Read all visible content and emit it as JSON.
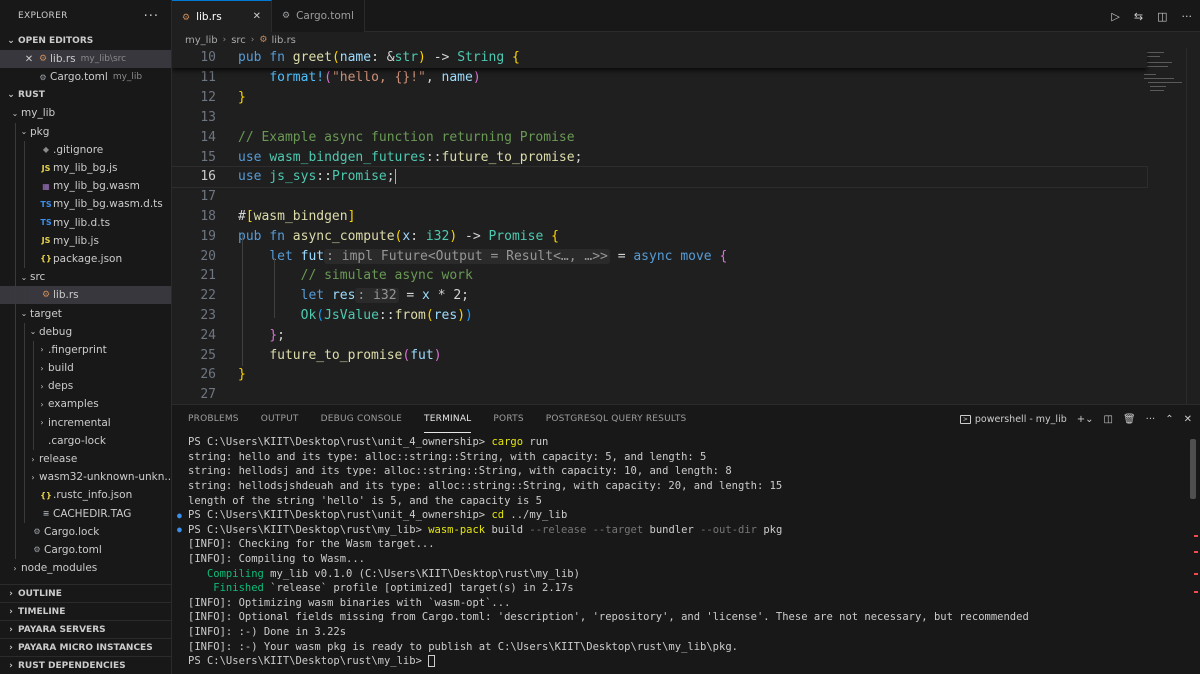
{
  "sidebar": {
    "title": "EXPLORER",
    "more": "···",
    "open_editors_label": "OPEN EDITORS",
    "open_editors": [
      {
        "name": "lib.rs",
        "desc": "my_lib\\src",
        "icon": "rust-file-icon"
      },
      {
        "name": "Cargo.toml",
        "desc": "my_lib",
        "icon": "toml-file-icon"
      }
    ],
    "workspace_label": "RUST",
    "tree": [
      {
        "label": "my_lib",
        "chev": "⌄",
        "icon": "",
        "depth": 1
      },
      {
        "label": "pkg",
        "chev": "⌄",
        "icon": "",
        "depth": 2
      },
      {
        "label": ".gitignore",
        "chev": "",
        "icon": "◆",
        "cls": "ic-git",
        "depth": 3
      },
      {
        "label": "my_lib_bg.js",
        "chev": "",
        "icon": "JS",
        "cls": "ic-js",
        "depth": 3
      },
      {
        "label": "my_lib_bg.wasm",
        "chev": "",
        "icon": "▦",
        "cls": "ic-wasm",
        "depth": 3
      },
      {
        "label": "my_lib_bg.wasm.d.ts",
        "chev": "",
        "icon": "TS",
        "cls": "ic-ts",
        "depth": 3
      },
      {
        "label": "my_lib.d.ts",
        "chev": "",
        "icon": "TS",
        "cls": "ic-ts",
        "depth": 3
      },
      {
        "label": "my_lib.js",
        "chev": "",
        "icon": "JS",
        "cls": "ic-js",
        "depth": 3
      },
      {
        "label": "package.json",
        "chev": "",
        "icon": "{}",
        "cls": "ic-json",
        "depth": 3
      },
      {
        "label": "src",
        "chev": "⌄",
        "icon": "",
        "depth": 2
      },
      {
        "label": "lib.rs",
        "chev": "",
        "icon": "⚙",
        "cls": "ic-rs",
        "depth": 3,
        "active": true
      },
      {
        "label": "target",
        "chev": "⌄",
        "icon": "",
        "depth": 2
      },
      {
        "label": "debug",
        "chev": "⌄",
        "icon": "",
        "depth": 3
      },
      {
        "label": ".fingerprint",
        "chev": "›",
        "icon": "",
        "depth": 4
      },
      {
        "label": "build",
        "chev": "›",
        "icon": "",
        "depth": 4
      },
      {
        "label": "deps",
        "chev": "›",
        "icon": "",
        "depth": 4
      },
      {
        "label": "examples",
        "chev": "›",
        "icon": "",
        "depth": 4
      },
      {
        "label": "incremental",
        "chev": "›",
        "icon": "",
        "depth": 4
      },
      {
        "label": ".cargo-lock",
        "chev": "",
        "icon": "",
        "depth": 4
      },
      {
        "label": "release",
        "chev": "›",
        "icon": "",
        "depth": 3
      },
      {
        "label": "wasm32-unknown-unkn...",
        "chev": "›",
        "icon": "",
        "depth": 3
      },
      {
        "label": ".rustc_info.json",
        "chev": "",
        "icon": "{}",
        "cls": "ic-json",
        "depth": 3
      },
      {
        "label": "CACHEDIR.TAG",
        "chev": "",
        "icon": "≡",
        "cls": "ic-toml",
        "depth": 3
      },
      {
        "label": "Cargo.lock",
        "chev": "",
        "icon": "⚙",
        "cls": "ic-toml",
        "depth": 2
      },
      {
        "label": "Cargo.toml",
        "chev": "",
        "icon": "⚙",
        "cls": "ic-toml",
        "depth": 2
      },
      {
        "label": "node_modules",
        "chev": "›",
        "icon": "",
        "depth": 1
      }
    ],
    "bottom_sections": [
      "OUTLINE",
      "TIMELINE",
      "PAYARA SERVERS",
      "PAYARA MICRO INSTANCES",
      "RUST DEPENDENCIES"
    ]
  },
  "tabs": [
    {
      "label": "lib.rs",
      "active": true,
      "icon": "rust-file-icon"
    },
    {
      "label": "Cargo.toml",
      "active": false,
      "icon": "toml-file-icon"
    }
  ],
  "tab_actions": [
    "run-icon",
    "compare-icon",
    "split-editor-icon",
    "more-icon"
  ],
  "breadcrumb": [
    "my_lib",
    "src",
    "lib.rs"
  ],
  "editor": {
    "cursor_line": 16,
    "sticky_line": {
      "num": "10",
      "tokens": [
        [
          "kw",
          "pub "
        ],
        [
          "kw",
          "fn "
        ],
        [
          "fn",
          "greet"
        ],
        [
          "br1",
          "("
        ],
        [
          "vr",
          "name"
        ],
        [
          "tx",
          ": &"
        ],
        [
          "ty",
          "str"
        ],
        [
          "br1",
          ")"
        ],
        [
          "tx",
          " -> "
        ],
        [
          "ty",
          "String"
        ],
        [
          "tx",
          " "
        ],
        [
          "br1",
          "{"
        ]
      ]
    },
    "lines": [
      {
        "num": "11",
        "tokens": [
          [
            "tx",
            "    "
          ],
          [
            "mac",
            "format!"
          ],
          [
            "br2",
            "("
          ],
          [
            "st",
            "\"hello, {}!\""
          ],
          [
            "tx",
            ", "
          ],
          [
            "vr",
            "name"
          ],
          [
            "br2",
            ")"
          ]
        ]
      },
      {
        "num": "12",
        "tokens": [
          [
            "br1",
            "}"
          ]
        ]
      },
      {
        "num": "13",
        "tokens": []
      },
      {
        "num": "14",
        "tokens": [
          [
            "cm",
            "// Example async function returning Promise"
          ]
        ]
      },
      {
        "num": "15",
        "tokens": [
          [
            "kw",
            "use "
          ],
          [
            "ty",
            "wasm_bindgen_futures"
          ],
          [
            "tx",
            "::"
          ],
          [
            "fn",
            "future_to_promise"
          ],
          [
            "tx",
            ";"
          ]
        ]
      },
      {
        "num": "16",
        "tokens": [
          [
            "kw",
            "use "
          ],
          [
            "ty",
            "js_sys"
          ],
          [
            "tx",
            "::"
          ],
          [
            "ty",
            "Promise"
          ],
          [
            "tx",
            ";"
          ],
          [
            "caret",
            ""
          ]
        ]
      },
      {
        "num": "17",
        "tokens": []
      },
      {
        "num": "18",
        "tokens": [
          [
            "tx",
            "#"
          ],
          [
            "br1",
            "["
          ],
          [
            "fn",
            "wasm_bindgen"
          ],
          [
            "br1",
            "]"
          ]
        ]
      },
      {
        "num": "19",
        "tokens": [
          [
            "kw",
            "pub "
          ],
          [
            "kw",
            "fn "
          ],
          [
            "fn",
            "async_compute"
          ],
          [
            "br1",
            "("
          ],
          [
            "vr",
            "x"
          ],
          [
            "tx",
            ": "
          ],
          [
            "ty",
            "i32"
          ],
          [
            "br1",
            ")"
          ],
          [
            "tx",
            " -> "
          ],
          [
            "ty",
            "Promise"
          ],
          [
            "tx",
            " "
          ],
          [
            "br1",
            "{"
          ]
        ]
      },
      {
        "num": "20",
        "tokens": [
          [
            "tx",
            "    "
          ],
          [
            "kw",
            "let "
          ],
          [
            "vr",
            "fut"
          ],
          [
            "hint",
            ": impl Future<Output = Result<…, …>>"
          ],
          [
            "tx",
            " = "
          ],
          [
            "kw",
            "async "
          ],
          [
            "kw",
            "move "
          ],
          [
            "br2",
            "{"
          ]
        ]
      },
      {
        "num": "21",
        "tokens": [
          [
            "tx",
            "        "
          ],
          [
            "cm",
            "// simulate async work"
          ]
        ]
      },
      {
        "num": "22",
        "tokens": [
          [
            "tx",
            "        "
          ],
          [
            "kw",
            "let "
          ],
          [
            "vr",
            "res"
          ],
          [
            "hint",
            ": i32"
          ],
          [
            "tx",
            " = "
          ],
          [
            "vr",
            "x"
          ],
          [
            "tx",
            " * "
          ],
          [
            "tx",
            "2;"
          ]
        ]
      },
      {
        "num": "23",
        "tokens": [
          [
            "tx",
            "        "
          ],
          [
            "ty",
            "Ok"
          ],
          [
            "br3",
            "("
          ],
          [
            "ty",
            "JsValue"
          ],
          [
            "tx",
            "::"
          ],
          [
            "fn",
            "from"
          ],
          [
            "br1",
            "("
          ],
          [
            "vr",
            "res"
          ],
          [
            "br1",
            ")"
          ],
          [
            "br3",
            ")"
          ]
        ]
      },
      {
        "num": "24",
        "tokens": [
          [
            "tx",
            "    "
          ],
          [
            "br2",
            "}"
          ],
          [
            "tx",
            ";"
          ]
        ]
      },
      {
        "num": "25",
        "tokens": [
          [
            "tx",
            "    "
          ],
          [
            "fn",
            "future_to_promise"
          ],
          [
            "br2",
            "("
          ],
          [
            "vr",
            "fut"
          ],
          [
            "br2",
            ")"
          ]
        ]
      },
      {
        "num": "26",
        "tokens": [
          [
            "br1",
            "}"
          ]
        ]
      },
      {
        "num": "27",
        "tokens": []
      }
    ]
  },
  "panel": {
    "tabs": [
      "PROBLEMS",
      "OUTPUT",
      "DEBUG CONSOLE",
      "TERMINAL",
      "PORTS",
      "POSTGRESQL QUERY RESULTS"
    ],
    "active_tab": "TERMINAL",
    "shell_label": "powershell - my_lib",
    "terminal": [
      {
        "dot": false,
        "parts": [
          [
            "",
            "PS C:\\Users\\KIIT\\Desktop\\rust\\unit_4_ownership> "
          ],
          [
            "t-yel",
            "cargo"
          ],
          [
            "",
            " run"
          ]
        ]
      },
      {
        "dot": false,
        "parts": [
          [
            "",
            "string: hello and its type: alloc::string::String, with capacity: 5, and length: 5"
          ]
        ]
      },
      {
        "dot": false,
        "parts": [
          [
            "",
            "string: hellodsj and its type: alloc::string::String, with capacity: 10, and length: 8"
          ]
        ]
      },
      {
        "dot": false,
        "parts": [
          [
            "",
            "string: hellodsjshdeuah and its type: alloc::string::String, with capacity: 20, and length: 15"
          ]
        ]
      },
      {
        "dot": false,
        "parts": [
          [
            "",
            "length of the string 'hello' is 5, and the capacity is 5"
          ]
        ]
      },
      {
        "dot": true,
        "parts": [
          [
            "",
            "PS C:\\Users\\KIIT\\Desktop\\rust\\unit_4_ownership> "
          ],
          [
            "t-yel",
            "cd"
          ],
          [
            "",
            " ../my_lib"
          ]
        ]
      },
      {
        "dot": true,
        "parts": [
          [
            "",
            "PS C:\\Users\\KIIT\\Desktop\\rust\\my_lib> "
          ],
          [
            "t-yel",
            "wasm-pack"
          ],
          [
            "",
            " build "
          ],
          [
            "t-gry",
            "--release --target"
          ],
          [
            "",
            " bundler "
          ],
          [
            "t-gry",
            "--out-dir"
          ],
          [
            "",
            " pkg"
          ]
        ]
      },
      {
        "dot": false,
        "parts": [
          [
            "",
            "[INFO]: Checking for the Wasm target..."
          ]
        ]
      },
      {
        "dot": false,
        "parts": [
          [
            "",
            "[INFO]: Compiling to Wasm..."
          ]
        ]
      },
      {
        "dot": false,
        "parts": [
          [
            "t-grn",
            "   Compiling"
          ],
          [
            "",
            " my_lib v0.1.0 (C:\\Users\\KIIT\\Desktop\\rust\\my_lib)"
          ]
        ]
      },
      {
        "dot": false,
        "parts": [
          [
            "t-grn",
            "    Finished"
          ],
          [
            "",
            " `release` profile [optimized] target(s) in 2.17s"
          ]
        ]
      },
      {
        "dot": false,
        "parts": [
          [
            "",
            "[INFO]: Optimizing wasm binaries with `wasm-opt`..."
          ]
        ]
      },
      {
        "dot": false,
        "parts": [
          [
            "",
            "[INFO]: Optional fields missing from Cargo.toml: 'description', 'repository', and 'license'. These are not necessary, but recommended"
          ]
        ]
      },
      {
        "dot": false,
        "parts": [
          [
            "",
            "[INFO]: :-) Done in 3.22s"
          ]
        ]
      },
      {
        "dot": false,
        "parts": [
          [
            "",
            "[INFO]: :-) Your wasm pkg is ready to publish at C:\\Users\\KIIT\\Desktop\\rust\\my_lib\\pkg."
          ]
        ]
      },
      {
        "dot": false,
        "parts": [
          [
            "",
            "PS C:\\Users\\KIIT\\Desktop\\rust\\my_lib> "
          ],
          [
            "cursor",
            ""
          ]
        ]
      }
    ]
  }
}
